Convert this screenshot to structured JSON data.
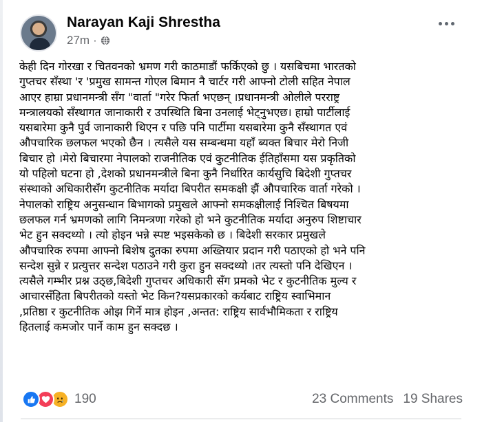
{
  "post": {
    "author_name": "Narayan Kaji Shrestha",
    "timestamp": "27m",
    "visibility_separator": "·",
    "visibility_icon": "globe-icon",
    "more_icon": "more-options-icon",
    "text": "केही दिन गोरखा र चितवनको भ्रमण गरी काठमाडौं फर्किएको छु । यसबिचमा भारतको\nगुप्तचर सँस्था 'र 'प्रमुख सामन्त गोएल बिमान नै चार्टर गरी आफ्नो टोली सहित नेपाल\nआएर हाम्रा प्रधानमन्त्री सँग \"वार्ता \"गरेर फिर्ता भएछन् ।प्रधानमन्त्री ओलीले परराष्ट्र\nमन्त्रालयको सँस्थागत जानाकारी र उपस्थिति बिना उनलाई भेट्नुभएछ। हाम्रो पार्टीलाई\nयसबारेमा कुनै पुर्व जानाकारी थिएन र पछि पनि पार्टीमा यसबारेमा कुनै सँस्थागत एवं\nऔपचारिक छलफल भएको छैन । त्यसैले यस सम्बन्धमा यहाँ ब्यक्त बिचार मेरो निजी\nबिचार हो ।मेरो बिचारमा नेपालको राजनीतिक एवं कुटनीतिक ईतिहाँसमा यस प्रकृतिको\nयो पहिलो घटना हो ,देशको प्रधानमन्त्रीले बिना कुनै निर्धारित कार्यसुचि बिदेशी गुप्तचर\nसंस्थाको अधिकारीसँग कुटनीतिक मर्यादा बिपरीत समकक्षी झैं औपचारिक वार्ता गरेको ।\nनेपालको राष्ट्रिय अनुसन्धान बिभागको प्रमुखले आफ्नो समकक्षीलाई निश्चित बिषयमा\nछलफल गर्न भ्रमणको लागि निमन्त्रणा गरेको हो भने कुटनीतिक मर्यादा अनुरुप शिष्टाचार\nभेट हुन सक्दथ्यो । त्यो होइन भन्ने स्पष्ट भइसकेको छ । बिदेशी सरकार प्रमुखले\nऔपचारिक रुपमा आफ्नो बिशेष दुतका  रुपमा अख्तियार प्रदान गरी पठाएको हो भने पनि\nसन्देश सुन्ने र प्रत्युत्तर सन्देश पठाउने गरी कुरा हुन सक्दथ्यो ।तर त्यस्तो पनि देखिएन ।\nत्यसैले गम्भीर प्रश्न उठ्छ,बिदेशी गुप्तचर अधिकारी सँग प्रमको भेट र कुटनीतिक मुल्य र\nआचारसँहिता बिपरीतको यस्तो भेट किन?यसप्रकारको कर्यबाट राष्ट्रिय स्वाभिमान\n,प्रतिष्ठा र कुटनीतिक ओझ गिर्ने मात्र होइन ,अन्तत: राष्ट्रिय सार्वभौमिकता र राष्ट्रिय\nहितलाई कमजोर पार्ने काम हुन सक्दछ  ।"
  },
  "reactions": {
    "icons": [
      "like-icon",
      "love-icon",
      "sad-icon"
    ],
    "count": "190",
    "comments": "23 Comments",
    "shares": "19 Shares",
    "colors": {
      "like": "#1877f2",
      "love": "#f33e58",
      "sad": "#f7b125",
      "muted_text": "#65676b"
    }
  }
}
